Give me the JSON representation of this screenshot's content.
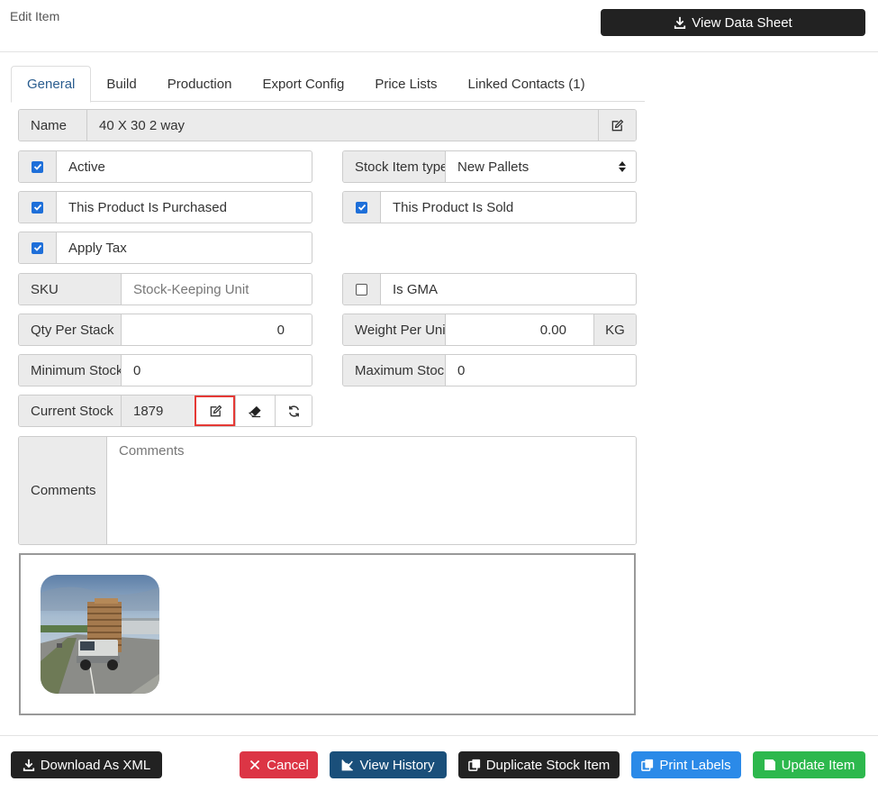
{
  "page": {
    "title": "Edit Item"
  },
  "header": {
    "view_data_sheet": "View Data Sheet"
  },
  "tabs": [
    {
      "label": "General"
    },
    {
      "label": "Build"
    },
    {
      "label": "Production"
    },
    {
      "label": "Export Config"
    },
    {
      "label": "Price Lists"
    },
    {
      "label": "Linked Contacts (1)"
    }
  ],
  "form": {
    "name": {
      "label": "Name",
      "value": "40 X 30 2 way"
    },
    "active": {
      "label": "Active",
      "checked": true
    },
    "stock_item_type": {
      "label": "Stock Item type",
      "value": "New Pallets"
    },
    "purchased": {
      "label": "This Product Is Purchased",
      "checked": true
    },
    "sold": {
      "label": "This Product Is Sold",
      "checked": true
    },
    "apply_tax": {
      "label": "Apply Tax",
      "checked": true
    },
    "sku": {
      "label": "SKU",
      "placeholder": "Stock-Keeping Unit"
    },
    "is_gma": {
      "label": "Is GMA",
      "checked": false
    },
    "qty_per_stack": {
      "label": "Qty Per Stack",
      "value": "0"
    },
    "weight_per_unit": {
      "label": "Weight Per Unit",
      "value": "0.00",
      "unit": "KG"
    },
    "minimum_stock": {
      "label": "Minimum Stock",
      "value": "0"
    },
    "maximum_stock": {
      "label": "Maximum Stock",
      "value": "0"
    },
    "current_stock": {
      "label": "Current Stock",
      "value": "1879"
    },
    "comments": {
      "label": "Comments",
      "placeholder": "Comments"
    }
  },
  "footer": {
    "download_xml": "Download As XML",
    "cancel": "Cancel",
    "view_history": "View History",
    "duplicate": "Duplicate Stock Item",
    "print_labels": "Print Labels",
    "update": "Update Item"
  },
  "colors": {
    "dark": "#222222",
    "cancel": "#dc3545",
    "history": "#1a4f7a",
    "print": "#2b8ae8",
    "update": "#2db84d",
    "checkbox": "#1e6fd9",
    "highlight": "#e53935"
  }
}
